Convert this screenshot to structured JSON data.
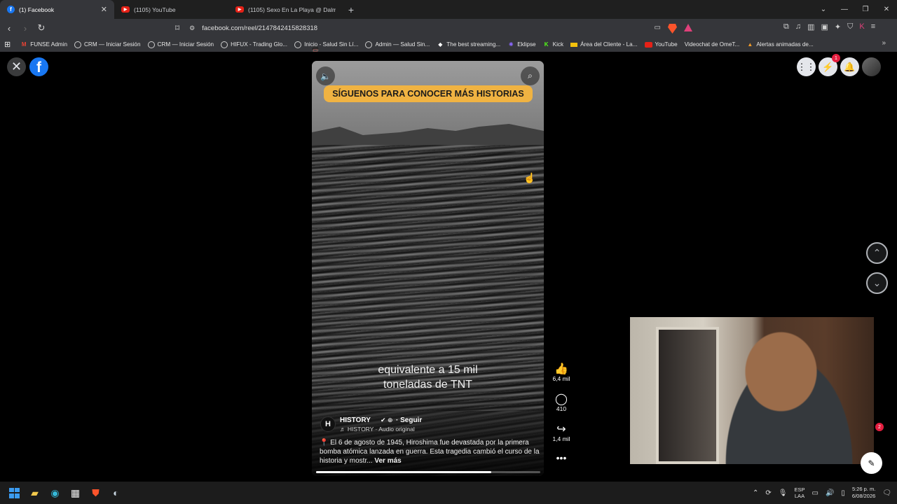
{
  "tabs": [
    {
      "title": "(1) Facebook",
      "favicon": "facebook-favicon",
      "active": true
    },
    {
      "title": "(1105) YouTube",
      "favicon": "youtube-favicon",
      "active": false
    },
    {
      "title": "(1105) Sexo En La Playa @ Dalmata -",
      "favicon": "youtube-favicon",
      "active": false
    }
  ],
  "toolbar": {
    "url": "facebook.com/reel/2147842415828318"
  },
  "bookmarks": [
    {
      "label": "FUNSE Admin",
      "icon": "gmail-icon"
    },
    {
      "label": "CRM — Iniciar Sesión",
      "icon": "globe-icon"
    },
    {
      "label": "CRM — Iniciar Sesión",
      "icon": "globe-icon"
    },
    {
      "label": "HIFUX - Trading Glo...",
      "icon": "globe-icon"
    },
    {
      "label": "Inicio - Salud Sin Lí...",
      "icon": "globe-icon"
    },
    {
      "label": "Admin — Salud Sin...",
      "icon": "globe-icon"
    },
    {
      "label": "The best streaming...",
      "icon": "diamond-icon"
    },
    {
      "label": "Eklipse",
      "icon": "eklipse-icon"
    },
    {
      "label": "Kick",
      "icon": "kick-icon"
    },
    {
      "label": "Área del Cliente - La...",
      "icon": "flag-icon"
    },
    {
      "label": "YouTube",
      "icon": "youtube-icon"
    },
    {
      "label": "Videochat de OmeT...",
      "icon": "video-icon"
    },
    {
      "label": "Alertas animadas de...",
      "icon": "alert-icon"
    }
  ],
  "header": {
    "notifications_badge": "1"
  },
  "reel": {
    "banner": "SÍGUENOS PARA CONOCER MÁS HISTORIAS",
    "caption_line1": "equivalente a 15 mil",
    "caption_line2": "toneladas de TNT",
    "author_logo": "H",
    "author_name": "HISTORY",
    "follow": "· Seguir",
    "audio": "♬ HISTORY · Audio original",
    "description": "El 6 de agosto de 1945, Hiroshima fue devastada por la primera bomba atómica lanzada en guerra. Esta tragedia cambió el curso de la historia y mostr...",
    "see_more": "Ver más",
    "progress": 0.78
  },
  "actions": {
    "likes": "6,4 mil",
    "comments": "410",
    "shares": "1,4 mil"
  },
  "webcam": {
    "badge": "2"
  },
  "taskbar": {
    "lang_line1": "ESP",
    "lang_line2": "LAA",
    "time": "5:26 p. m.",
    "date": "6/08/2026"
  }
}
